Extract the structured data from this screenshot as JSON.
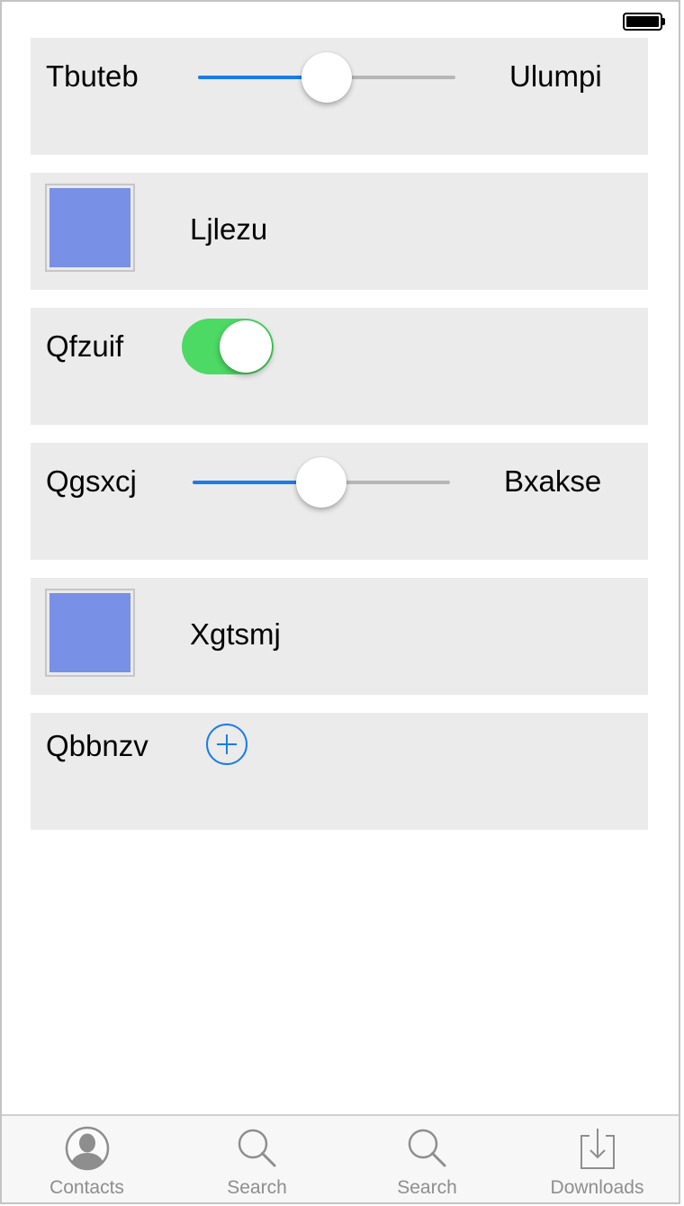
{
  "colors": {
    "row_bg": "#ebebeb",
    "accent": "#1a7ce9",
    "switch_on": "#4cd964",
    "swatch": "#7890e6",
    "tab_inactive": "#8e8e8e"
  },
  "rows": [
    {
      "type": "slider",
      "min_label": "Tbuteb",
      "max_label": "Ulumpi",
      "value": 0.5
    },
    {
      "type": "color-swatch",
      "label": "Ljlezu",
      "color": "#7890e6"
    },
    {
      "type": "switch",
      "label": "Qfzuif",
      "on": true
    },
    {
      "type": "slider",
      "min_label": "Qgsxcj",
      "max_label": "Bxakse",
      "value": 0.5
    },
    {
      "type": "color-swatch",
      "label": "Xgtsmj",
      "color": "#7890e6"
    },
    {
      "type": "add-button",
      "label": "Qbbnzv",
      "icon": "plus-circle-icon"
    }
  ],
  "tabbar": {
    "tabs": [
      {
        "label": "Contacts",
        "icon": "contacts-icon"
      },
      {
        "label": "Search",
        "icon": "search-icon"
      },
      {
        "label": "Search",
        "icon": "search-icon"
      },
      {
        "label": "Downloads",
        "icon": "downloads-icon"
      }
    ]
  },
  "status_bar": {
    "battery_icon": "battery-icon"
  }
}
